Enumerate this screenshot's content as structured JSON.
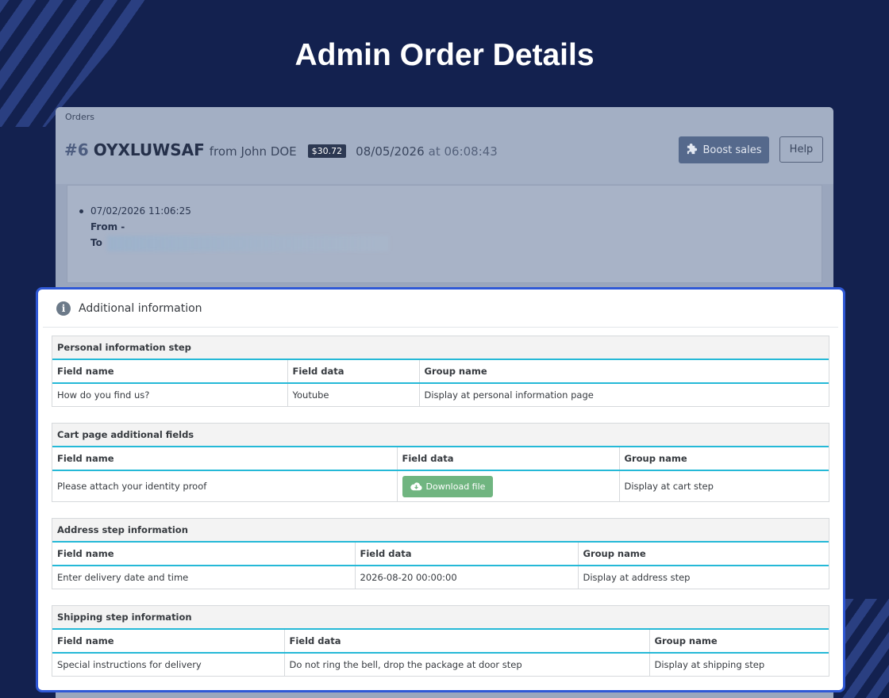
{
  "page": {
    "title": "Admin Order Details"
  },
  "admin": {
    "breadcrumb": "Orders",
    "order": {
      "number": "#6",
      "reference": "OYXLUWSAF",
      "from": "from John DOE",
      "total": "$30.72",
      "date": "08/05/2026",
      "at_time": "at 06:08:43"
    },
    "boost_label": "Boost sales",
    "help_label": "Help",
    "history": {
      "date": "07/02/2026 11:06:25",
      "from_label": "From -",
      "to_label": "To"
    }
  },
  "card": {
    "title": "Additional information",
    "sections": [
      {
        "title": "Personal information step",
        "headers": [
          "Field name",
          "Field data",
          "Group name"
        ],
        "row": [
          "How do you find us?",
          "Youtube",
          "Display at personal information page"
        ]
      },
      {
        "title": "Cart page additional fields",
        "headers": [
          "Field name",
          "Field data",
          "Group name"
        ],
        "row": [
          "Please attach your identity proof",
          "Download file",
          "Display at cart step"
        ]
      },
      {
        "title": "Address step information",
        "headers": [
          "Field name",
          "Field data",
          "Group name"
        ],
        "row": [
          "Enter delivery date and time",
          "2026-08-20 00:00:00",
          "Display at address step"
        ]
      },
      {
        "title": "Shipping step information",
        "headers": [
          "Field name",
          "Field data",
          "Group name"
        ],
        "row": [
          "Special instructions for delivery",
          "Do not ring the bell, drop the package at door step",
          "Display at shipping step"
        ]
      }
    ]
  },
  "colors": {
    "background": "#13214f",
    "card_border": "#2f58d6",
    "table_accent": "#25b9d7",
    "download_button": "#70b580"
  },
  "icons": [
    "info-icon",
    "puzzle-icon",
    "cloud-download-icon"
  ]
}
